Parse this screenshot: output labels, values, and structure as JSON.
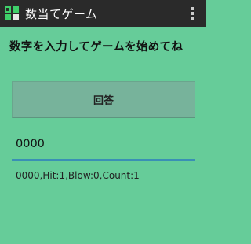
{
  "action_bar": {
    "title": "数当てゲーム",
    "app_icon": "app-icon",
    "overflow_icon": "overflow-menu-icon"
  },
  "main": {
    "prompt": "数字を入力してゲームを始めてね",
    "answer_button_label": "回答",
    "input_value": "0000",
    "result_text": "0000,Hit:1,Blow:0,Count:1"
  },
  "colors": {
    "background": "#66cc99",
    "action_bar": "#2a2a2a",
    "button": "#77b39b",
    "input_underline": "#3a8fb5"
  }
}
